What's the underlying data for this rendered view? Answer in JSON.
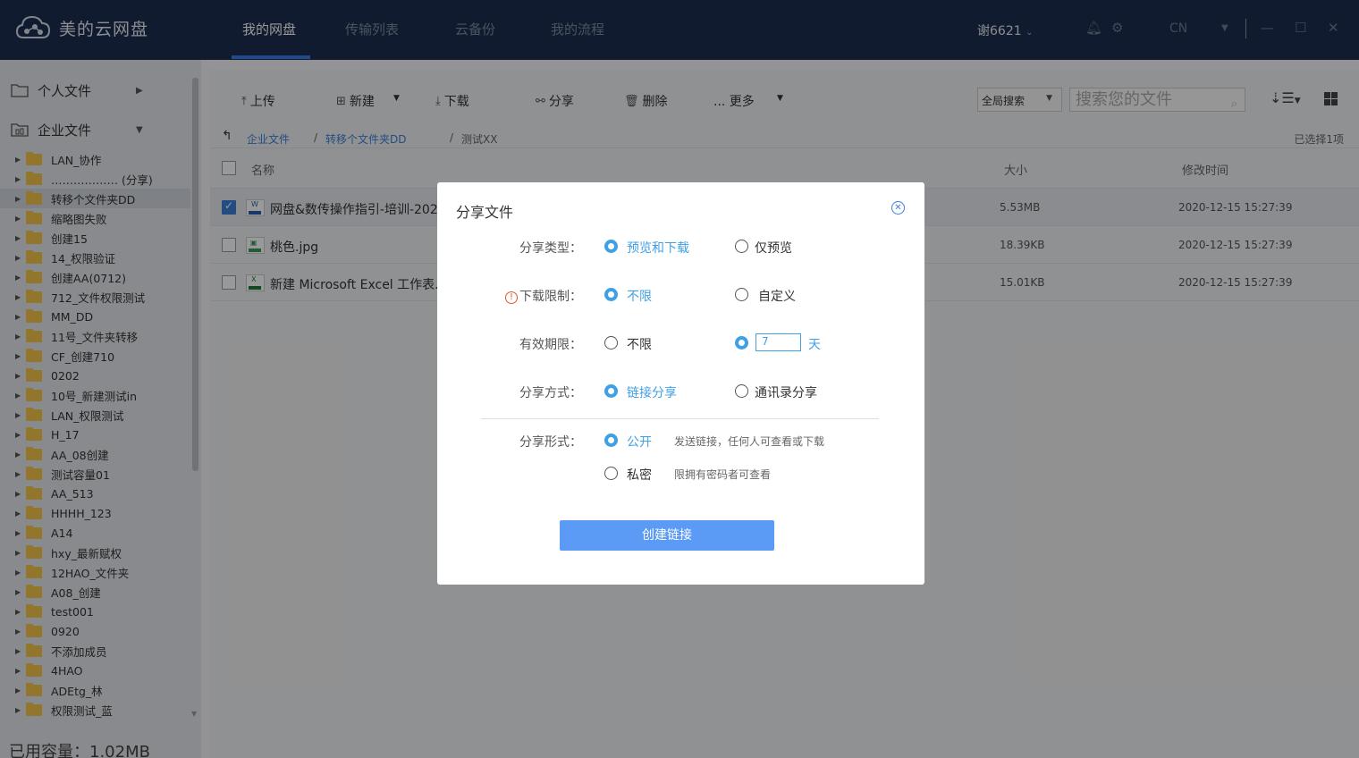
{
  "app": {
    "title": "美的云网盘"
  },
  "nav": {
    "tabs": [
      "我的网盘",
      "传输列表",
      "云备份",
      "我的流程"
    ]
  },
  "topbar": {
    "user": "谢6621",
    "language": "CN"
  },
  "sidebar": {
    "personal": "个人文件",
    "enterprise": "企业文件",
    "items": [
      "LAN_协作",
      "……………… (分享)",
      "转移个文件夹DD",
      "缩略图失败",
      "创建15",
      "14_权限验证",
      "创建AA(0712)",
      "712_文件权限测试",
      "MM_DD",
      "11号_文件夹转移",
      "CF_创建710",
      "0202",
      "10号_新建测试in",
      "LAN_权限测试",
      "H_17",
      "AA_08创建",
      "测试容量01",
      "AA_513",
      "HHHH_123",
      "A14",
      "hxy_最新赋权",
      "12HAO_文件夹",
      "A08_创建",
      "test001",
      "0920",
      "不添加成员",
      "4HAO",
      "ADEtg_林",
      "权限测试_蓝"
    ],
    "selected_index": 2,
    "capacity": "已用容量：1.02MB"
  },
  "toolbar": {
    "upload": "上传",
    "new": "新建",
    "download": "下载",
    "share": "分享",
    "delete": "删除",
    "more": "... 更多",
    "scope": "全局搜索",
    "search_placeholder": "搜索您的文件"
  },
  "breadcrumb": {
    "items": [
      "企业文件",
      "转移个文件夹DD",
      "测试XX"
    ],
    "selected_count": "已选择1项"
  },
  "table": {
    "headers": {
      "name": "名称",
      "size": "大小",
      "modified": "修改时间"
    },
    "rows": [
      {
        "name": "网盘&数传操作指引-培训-2020",
        "size": "5.53MB",
        "modified": "2020-12-15 15:27:39",
        "checked": true,
        "type": "word"
      },
      {
        "name": "桃色.jpg",
        "size": "18.39KB",
        "modified": "2020-12-15 15:27:39",
        "checked": false,
        "type": "image"
      },
      {
        "name": "新建 Microsoft Excel 工作表.xlsx",
        "size": "15.01KB",
        "modified": "2020-12-15 15:27:39",
        "checked": false,
        "type": "excel"
      }
    ]
  },
  "modal": {
    "title": "分享文件",
    "share_type": {
      "label": "分享类型：",
      "options": [
        "预览和下载",
        "仅预览"
      ],
      "selected": 0
    },
    "download_limit": {
      "label": "下载限制：",
      "options": [
        "不限",
        "自定义"
      ],
      "selected": 0
    },
    "validity": {
      "label": "有效期限：",
      "options": [
        "不限",
        ""
      ],
      "selected": 1,
      "days": "7",
      "unit": "天"
    },
    "share_method": {
      "label": "分享方式：",
      "options": [
        "链接分享",
        "通讯录分享"
      ],
      "selected": 0
    },
    "share_form": {
      "label": "分享形式：",
      "options": [
        "公开",
        "私密"
      ],
      "hints": [
        "发送链接，任何人可查看或下载",
        "限拥有密码者可查看"
      ],
      "selected": 0
    },
    "create_button": "创建链接"
  },
  "colors": {
    "topbar": "#1b2d4f",
    "accent": "#3fa0e6",
    "link": "#3f7fd8",
    "button": "#5b9af5"
  }
}
